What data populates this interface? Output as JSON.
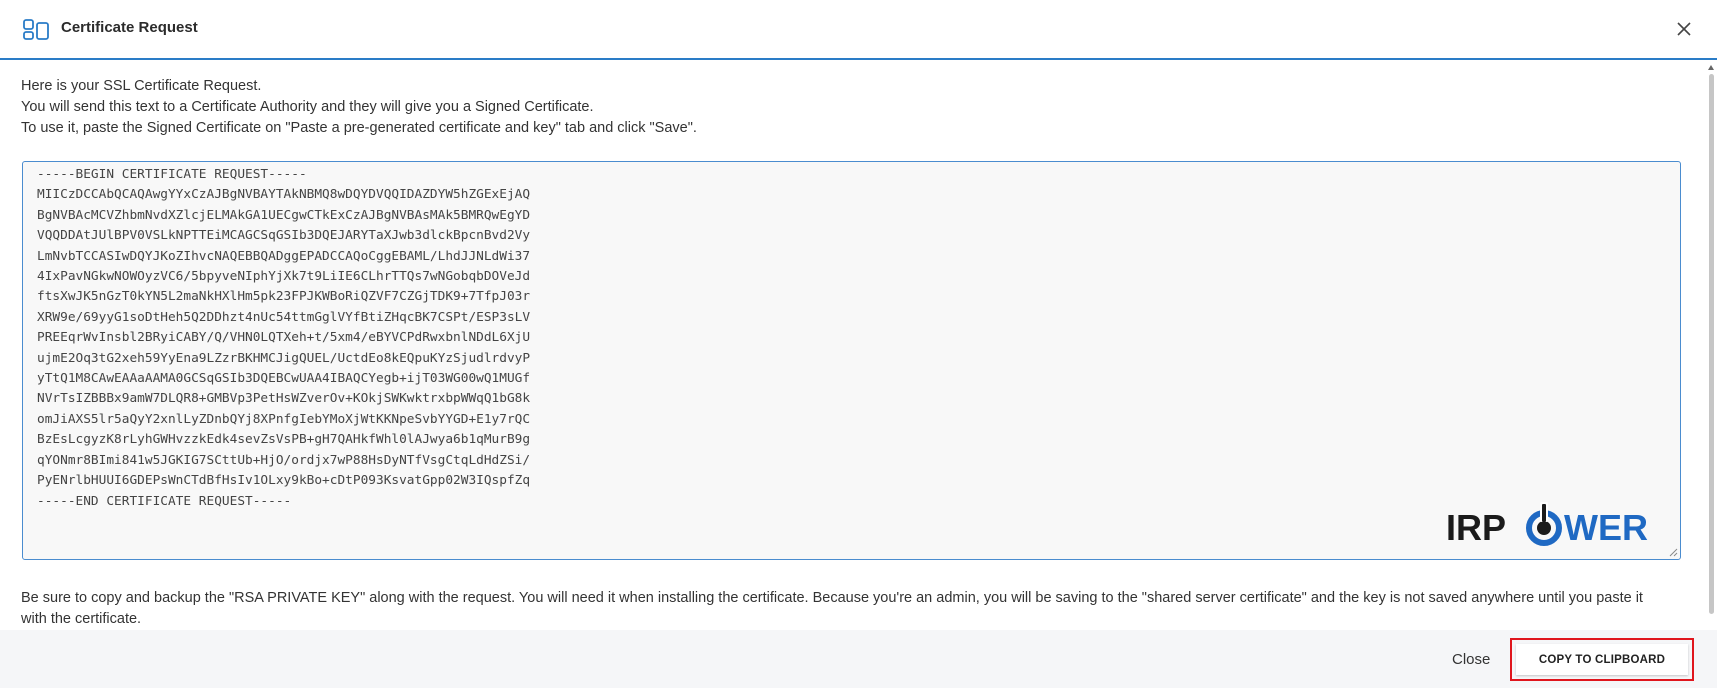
{
  "header": {
    "title": "Certificate Request",
    "icon": "certificate-request-icon",
    "accent_color": "#2a7cc7"
  },
  "intro": {
    "line1": "Here is your SSL Certificate Request.",
    "line2": "You will send this text to a Certificate Authority and they will give you a Signed Certificate.",
    "line3": "To use it, paste the Signed Certificate on \"Paste a pre-generated certificate and key\" tab and click \"Save\"."
  },
  "csr": {
    "text": "-----BEGIN CERTIFICATE REQUEST-----\nMIICzDCCAbQCAQAwgYYxCzAJBgNVBAYTAkNBMQ8wDQYDVQQIDAZDYW5hZGExEjAQ\nBgNVBAcMCVZhbmNvdXZlcjELMAkGA1UECgwCTkExCzAJBgNVBAsMAk5BMRQwEgYD\nVQQDDAtJUlBPV0VSLkNPTTEiMCAGCSqGSIb3DQEJARYTaXJwb3dlckBpcnBvd2Vy\nLmNvbTCCASIwDQYJKoZIhvcNAQEBBQADggEPADCCAQoCggEBAML/LhdJJNLdWi37\n4IxPavNGkwNOWOyzVC6/5bpyveNIphYjXk7t9LiIE6CLhrTTQs7wNGobqbDOVeJd\nftsXwJK5nGzT0kYN5L2maNkHXlHm5pk23FPJKWBoRiQZVF7CZGjTDK9+7TfpJ03r\nXRW9e/69yyG1soDtHeh5Q2DDhzt4nUc54ttmGglVYfBtiZHqcBK7CSPt/ESP3sLV\nPREEqrWvInsbl2BRyiCABY/Q/VHN0LQTXeh+t/5xm4/eBYVCPdRwxbnlNDdL6XjU\nujmE2Oq3tG2xeh59YyEna9LZzrBKHMCJigQUEL/UctdEo8kEQpuKYzSjudlrdvyP\nyTtQ1M8CAwEAAaAAMA0GCSqGSIb3DQEBCwUAA4IBAQCYegb+ijT03WG00wQ1MUGf\nNVrTsIZBBBx9amW7DLQR8+GMBVp3PetHsWZverOv+KOkjSWKwktrxbpWWqQ1bG8k\nomJiAXS5lr5aQyY2xnlLyZDnbQYj8XPnfgIebYMoXjWtKKNpeSvbYYGD+E1y7rQC\nBzEsLcgyzK8rLyhGWHvzzkEdk4sevZsVsPB+gH7QAHkfWhl0lAJwya6b1qMurB9g\nqYONmr8BImi841w5JGKIG7SCttUb+HjO/ordjx7wP88HsDyNTfVsgCtqLdHdZSi/\nPyENrlbHUUI6GDEPsWnCTdBfHsIv1OLxy9kBo+cDtP093KsvatGpp02W3IQspfZq\n-----END CERTIFICATE REQUEST-----",
    "border_color": "#4a8ccf"
  },
  "logo": {
    "text_left": "IRP",
    "text_right": "WER",
    "icon": "power-icon",
    "color_dark": "#1b1b1b",
    "color_blue": "#1f69c3"
  },
  "note": {
    "text": "Be sure to copy and backup the \"RSA PRIVATE KEY\" along with the request. You will need it when installing the certificate. Because you're an admin, you will be saving to the \"shared server certificate\" and the key is not saved anywhere until you paste it with the certificate."
  },
  "footer": {
    "close_label": "Close",
    "copy_label": "COPY TO CLIPBOARD",
    "highlight_color": "#e0161d"
  }
}
